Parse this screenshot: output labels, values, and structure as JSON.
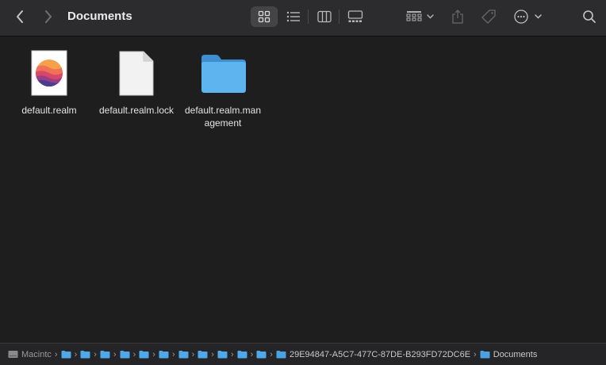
{
  "window": {
    "title": "Documents"
  },
  "toolbar": {
    "view_modes": [
      "icon",
      "list",
      "column",
      "gallery"
    ],
    "active_view": "icon",
    "icons": [
      "chevron-left-icon",
      "chevron-right-icon",
      "grid-icon",
      "list-icon",
      "columns-icon",
      "gallery-icon",
      "group-icon",
      "share-icon",
      "tag-icon",
      "more-icon",
      "search-icon"
    ]
  },
  "files": [
    {
      "name": "default.realm",
      "kind": "realm-document"
    },
    {
      "name": "default.realm.lock",
      "kind": "blank-document"
    },
    {
      "name": "default.realm.man\nagement",
      "kind": "folder"
    }
  ],
  "pathbar": {
    "disk": "Macintc",
    "hidden_folder_count": 11,
    "parent": "29E94847-A5C7-477C-87DE-B293FD72DC6E",
    "current": "Documents"
  },
  "colors": {
    "background": "#1e1e1e",
    "toolbar": "#2c2c2e",
    "folder": "#4fa8e8"
  }
}
